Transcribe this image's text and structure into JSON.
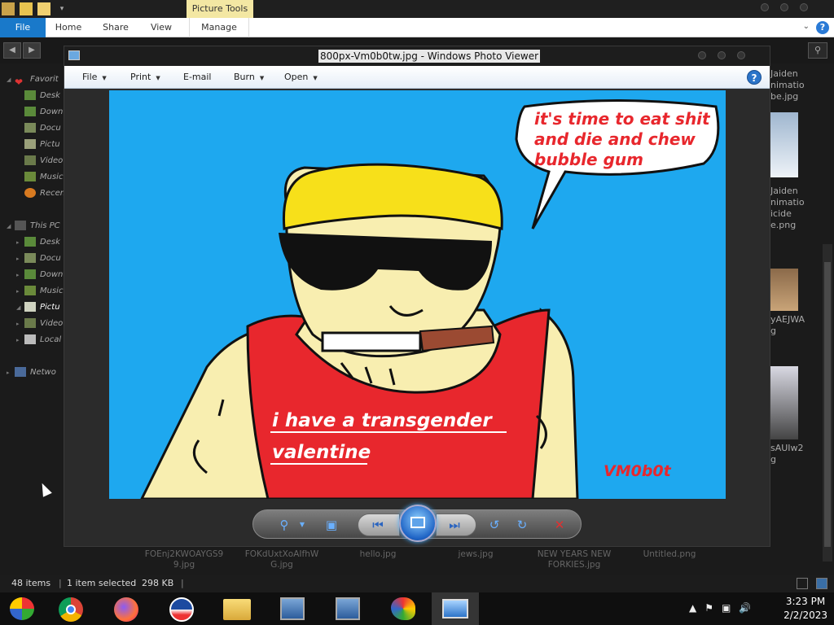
{
  "ribbon": {
    "contextual_tab": "Picture Tools",
    "tabs": [
      "File",
      "Home",
      "Share",
      "View",
      "Manage"
    ],
    "help": "?"
  },
  "nav": {
    "favorites": "Favorit",
    "fav_items": [
      "Desk",
      "Down",
      "Docu",
      "Pictu",
      "Video",
      "Music",
      "Recen"
    ],
    "this_pc": "This PC",
    "pc_items": [
      "Desk",
      "Docu",
      "Down",
      "Music",
      "Pictu",
      "Video",
      "Local"
    ],
    "network": "Netwo"
  },
  "peek": {
    "item1": [
      "Jaiden",
      "nimatio",
      "be.jpg"
    ],
    "item2": [
      "Jaiden",
      "nimatio",
      "icide",
      "e.png"
    ],
    "item3": [
      "yAEJWA",
      "g"
    ],
    "item4": [
      "sAUIw2",
      "g"
    ]
  },
  "files": [
    {
      "line1": "FOEnj2KWOAYGS9",
      "line2": "9.jpg"
    },
    {
      "line1": "FOKdUxtXoAIfhW",
      "line2": "G.jpg"
    },
    {
      "line1": "hello.jpg",
      "line2": ""
    },
    {
      "line1": "jews.jpg",
      "line2": ""
    },
    {
      "line1": "NEW YEARS NEW",
      "line2": "FORKIES.jpg"
    },
    {
      "line1": "Untitled.png",
      "line2": ""
    }
  ],
  "status": {
    "items": "48 items",
    "selected": "1 item selected",
    "size": "298 KB"
  },
  "viewer": {
    "title": "800px-Vm0b0tw.jpg - Windows Photo Viewer",
    "menu": [
      "File",
      "Print",
      "E-mail",
      "Burn",
      "Open"
    ],
    "help": "?"
  },
  "artwork": {
    "speech": [
      "it's time to eat shit",
      "and die and chew",
      "bubble gum"
    ],
    "caption": [
      "i have a transgender",
      "valentine"
    ],
    "signature": "VM0b0t"
  },
  "clock": {
    "time": "3:23 PM",
    "date": "2/2/2023"
  },
  "colors": {
    "accent": "#1979ca",
    "sky": "#1ea8ef",
    "shirt": "#e8272d",
    "skin": "#f8eeb0",
    "hair": "#f7e01a"
  }
}
